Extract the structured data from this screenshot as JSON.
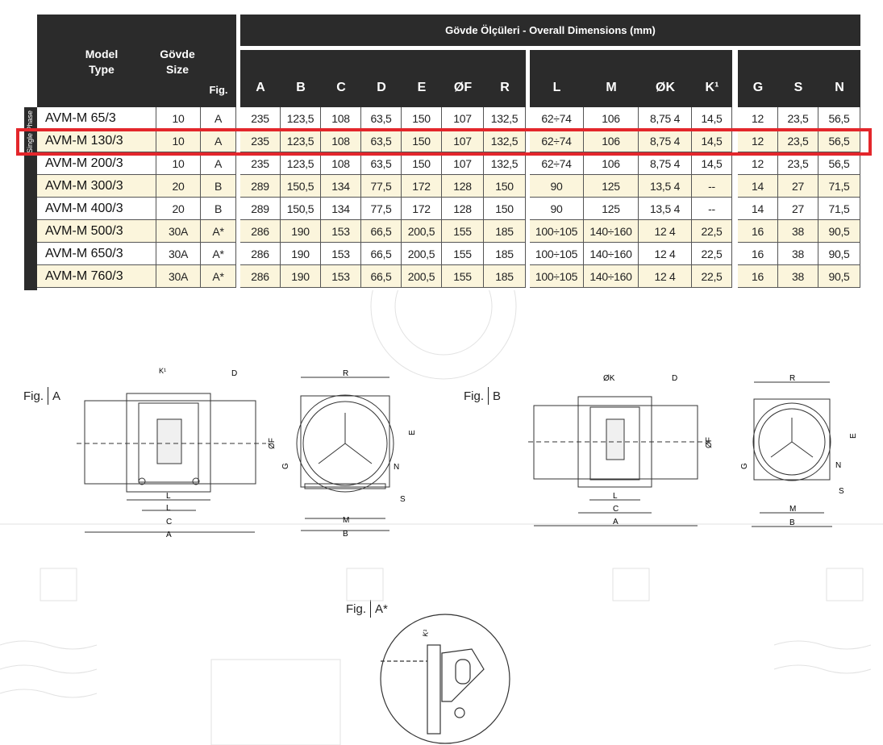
{
  "table": {
    "group_header": "Gövde Ölçüleri - Overall Dimensions (mm)",
    "model_header_line1": "Model",
    "model_header_line2": "Type",
    "size_header_line1": "Gövde",
    "size_header_line2": "Size",
    "fig_header": "Fig.",
    "side_label": "Single Phase",
    "columns": [
      "A",
      "B",
      "C",
      "D",
      "E",
      "ØF",
      "R",
      "L",
      "M",
      "ØK",
      "K¹",
      "G",
      "S",
      "N"
    ],
    "rows": [
      {
        "model": "AVM-M 65/3",
        "size": "10",
        "fig": "A",
        "A": "235",
        "B": "123,5",
        "C": "108",
        "D": "63,5",
        "E": "150",
        "F": "107",
        "R": "132,5",
        "L": "62÷74",
        "M": "106",
        "K": "8,75  4",
        "K1": "14,5",
        "G": "12",
        "S": "23,5",
        "N": "56,5"
      },
      {
        "model": "AVM-M 130/3",
        "size": "10",
        "fig": "A",
        "A": "235",
        "B": "123,5",
        "C": "108",
        "D": "63,5",
        "E": "150",
        "F": "107",
        "R": "132,5",
        "L": "62÷74",
        "M": "106",
        "K": "8,75  4",
        "K1": "14,5",
        "G": "12",
        "S": "23,5",
        "N": "56,5"
      },
      {
        "model": "AVM-M 200/3",
        "size": "10",
        "fig": "A",
        "A": "235",
        "B": "123,5",
        "C": "108",
        "D": "63,5",
        "E": "150",
        "F": "107",
        "R": "132,5",
        "L": "62÷74",
        "M": "106",
        "K": "8,75  4",
        "K1": "14,5",
        "G": "12",
        "S": "23,5",
        "N": "56,5"
      },
      {
        "model": "AVM-M 300/3",
        "size": "20",
        "fig": "B",
        "A": "289",
        "B": "150,5",
        "C": "134",
        "D": "77,5",
        "E": "172",
        "F": "128",
        "R": "150",
        "L": "90",
        "M": "125",
        "K": "13,5  4",
        "K1": "--",
        "G": "14",
        "S": "27",
        "N": "71,5"
      },
      {
        "model": "AVM-M 400/3",
        "size": "20",
        "fig": "B",
        "A": "289",
        "B": "150,5",
        "C": "134",
        "D": "77,5",
        "E": "172",
        "F": "128",
        "R": "150",
        "L": "90",
        "M": "125",
        "K": "13,5  4",
        "K1": "--",
        "G": "14",
        "S": "27",
        "N": "71,5"
      },
      {
        "model": "AVM-M 500/3",
        "size": "30A",
        "fig": "A*",
        "A": "286",
        "B": "190",
        "C": "153",
        "D": "66,5",
        "E": "200,5",
        "F": "155",
        "R": "185",
        "L": "100÷105",
        "M": "140÷160",
        "K": "12  4",
        "K1": "22,5",
        "G": "16",
        "S": "38",
        "N": "90,5"
      },
      {
        "model": "AVM-M 650/3",
        "size": "30A",
        "fig": "A*",
        "A": "286",
        "B": "190",
        "C": "153",
        "D": "66,5",
        "E": "200,5",
        "F": "155",
        "R": "185",
        "L": "100÷105",
        "M": "140÷160",
        "K": "12  4",
        "K1": "22,5",
        "G": "16",
        "S": "38",
        "N": "90,5"
      },
      {
        "model": "AVM-M 760/3",
        "size": "30A",
        "fig": "A*",
        "A": "286",
        "B": "190",
        "C": "153",
        "D": "66,5",
        "E": "200,5",
        "F": "155",
        "R": "185",
        "L": "100÷105",
        "M": "140÷160",
        "K": "12  4",
        "K1": "22,5",
        "G": "16",
        "S": "38",
        "N": "90,5"
      }
    ],
    "highlighted_row": 1
  },
  "figures": {
    "fig_word": "Fig.",
    "figA": {
      "name": "A",
      "labels": {
        "K1": "K¹",
        "D": "D",
        "R": "R",
        "F": "ØF",
        "E": "E",
        "G": "G",
        "N": "N",
        "S": "S",
        "L": "L",
        "C": "C",
        "A": "A",
        "M": "M",
        "B": "B"
      }
    },
    "figB": {
      "name": "B",
      "labels": {
        "K": "ØK",
        "D": "D",
        "R": "R",
        "F": "ØF",
        "E": "E",
        "G": "G",
        "N": "N",
        "S": "S",
        "L": "L",
        "C": "C",
        "A": "A",
        "M": "M",
        "B": "B"
      }
    },
    "figAstar": {
      "name": "A*",
      "labels": {
        "K1": "K¹"
      }
    }
  },
  "colors": {
    "header": "#2b2b2b",
    "highlight": "#e3262b",
    "row_alt": "#fbf5dc"
  }
}
